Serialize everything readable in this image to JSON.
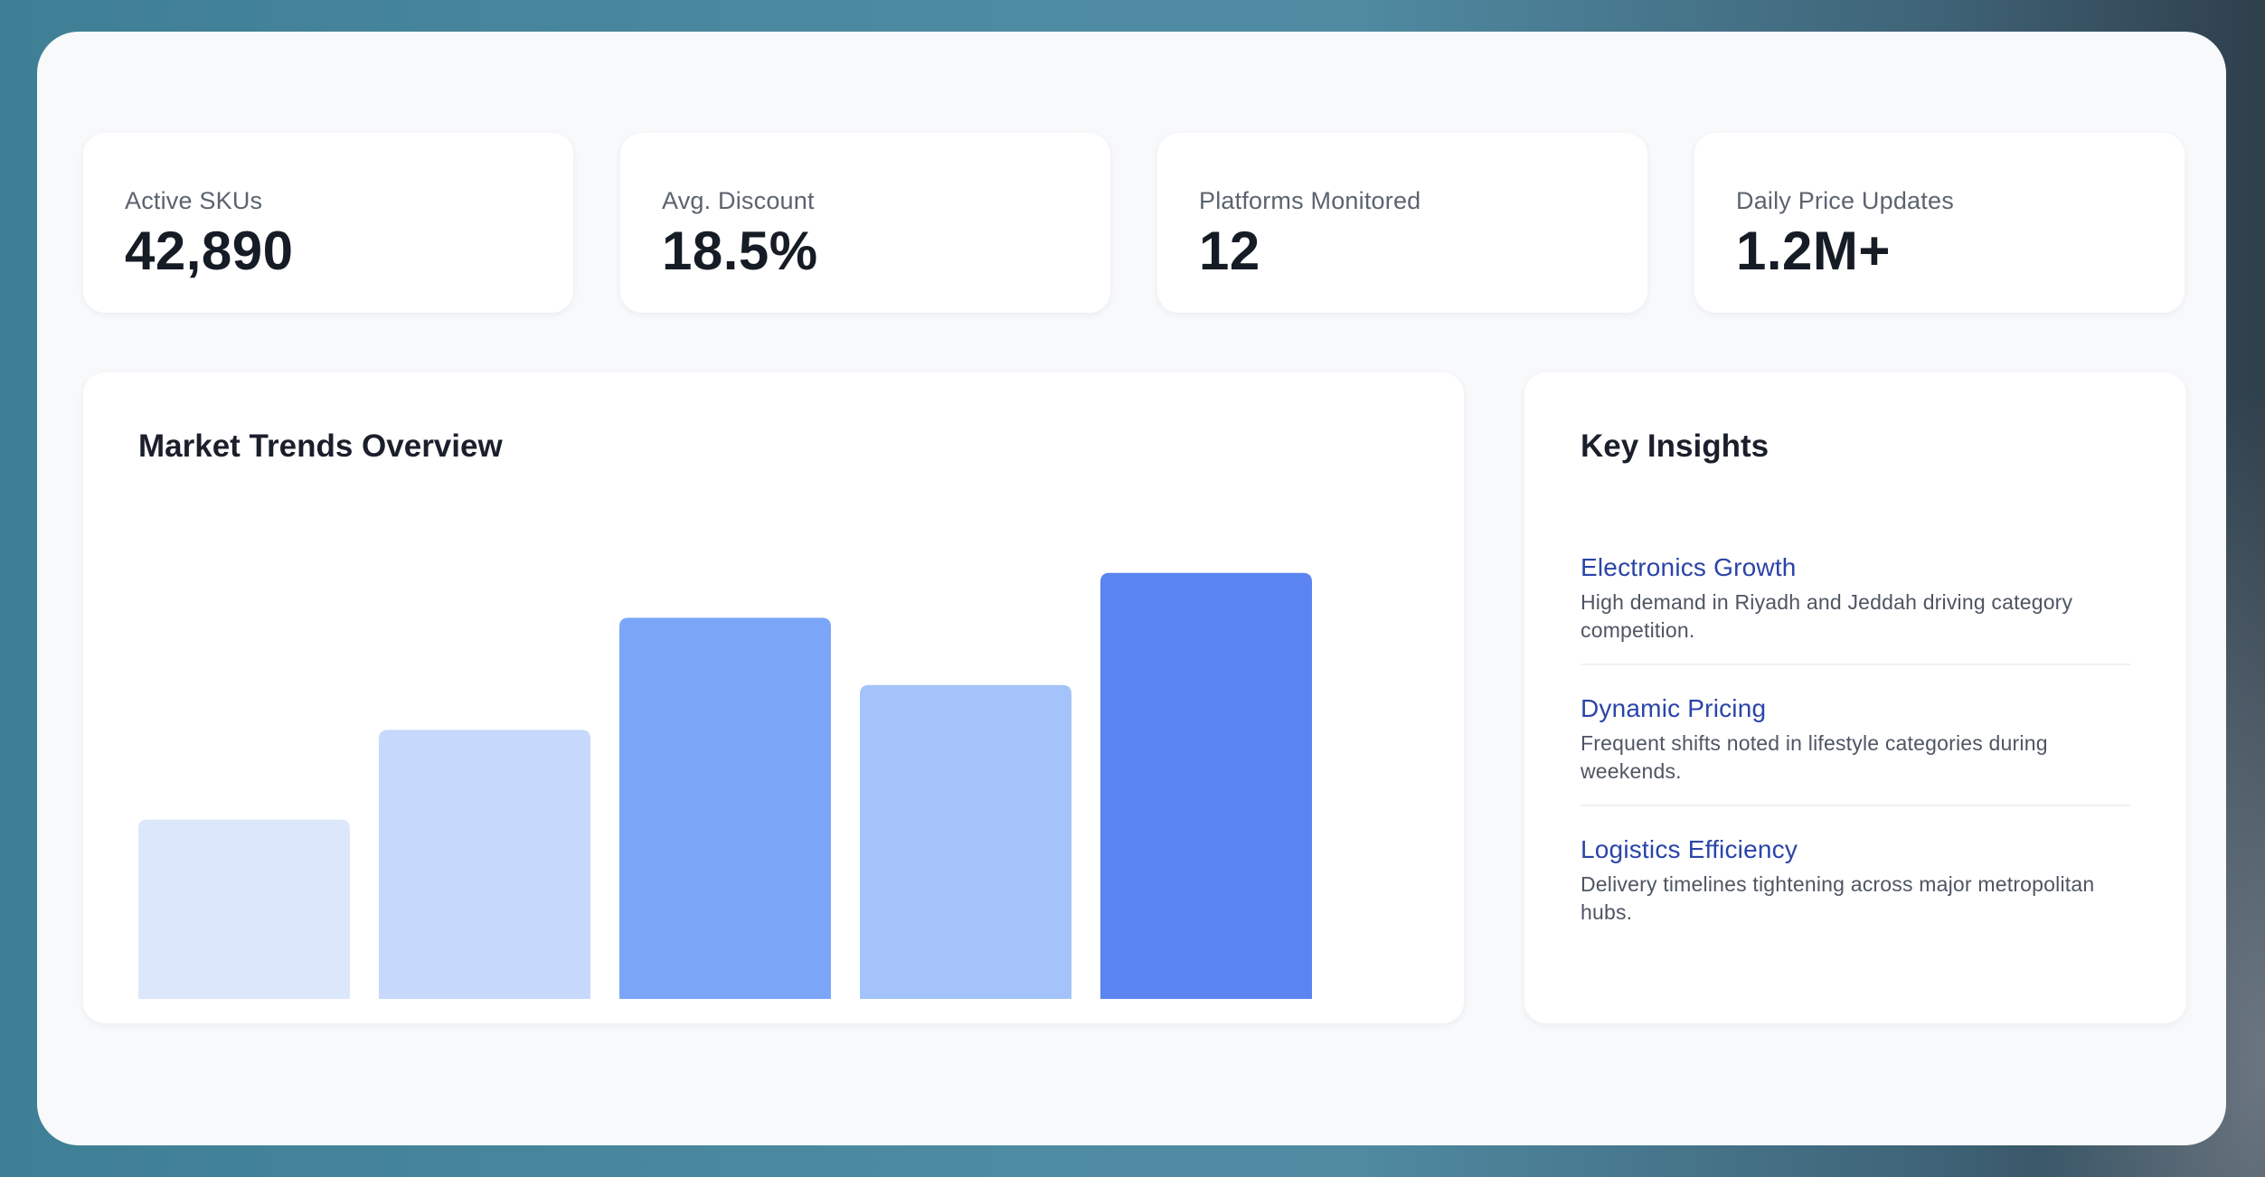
{
  "kpis": [
    {
      "label": "Active SKUs",
      "value": "42,890"
    },
    {
      "label": "Avg. Discount",
      "value": "18.5%"
    },
    {
      "label": "Platforms Monitored",
      "value": "12"
    },
    {
      "label": "Daily Price Updates",
      "value": "1.2M+"
    }
  ],
  "trends": {
    "title": "Market Trends Overview"
  },
  "chart_data": {
    "type": "bar",
    "values": [
      40,
      60,
      85,
      70,
      95
    ],
    "ylim": [
      0,
      100
    ],
    "colors": [
      "#dde7fb",
      "#c6d8fb",
      "#7ba6f7",
      "#a3c3fa",
      "#5a84f0"
    ],
    "grid": false
  },
  "insights": {
    "title": "Key Insights",
    "items": [
      {
        "title": "Electronics Growth",
        "desc": "High demand in Riyadh and Jeddah driving category competition."
      },
      {
        "title": "Dynamic Pricing",
        "desc": "Frequent shifts noted in lifestyle categories during weekends."
      },
      {
        "title": "Logistics Efficiency",
        "desc": "Delivery timelines tightening across major metropolitan hubs."
      }
    ]
  },
  "theme": {
    "accent": "#2a44a8",
    "text_dark": "#161c26",
    "text_muted": "#5b6370"
  }
}
